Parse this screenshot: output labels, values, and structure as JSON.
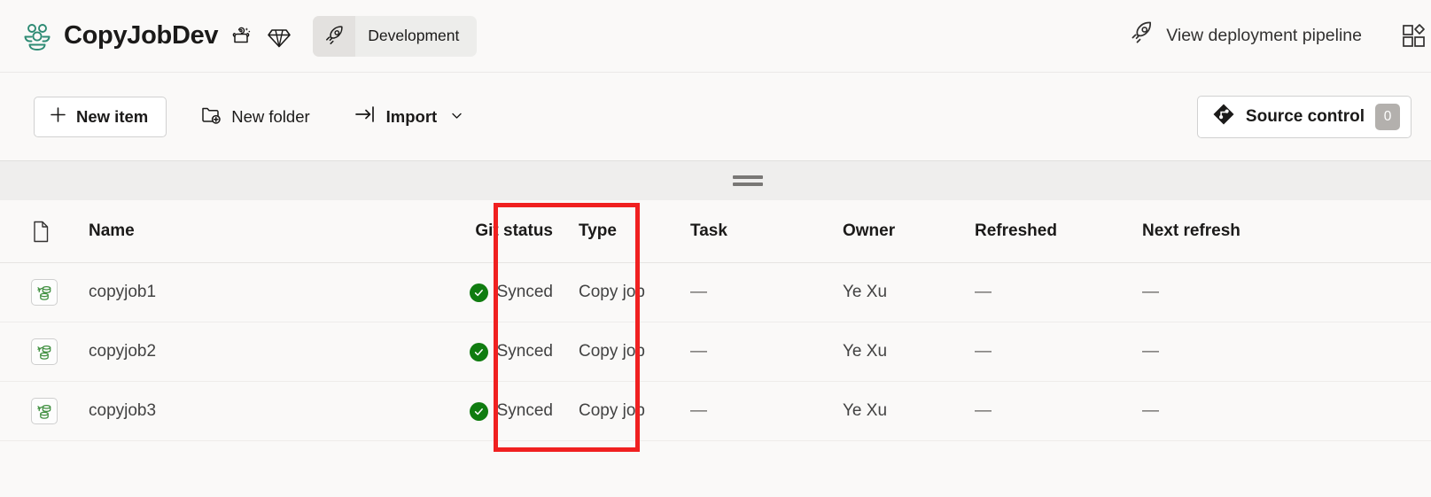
{
  "header": {
    "workspace_icon": "people-group-icon",
    "workspace_title": "CopyJobDev",
    "icons": [
      {
        "name": "copilot-sparkle-icon"
      },
      {
        "name": "premium-diamond-icon"
      }
    ],
    "stage_pill": {
      "icon": "rocket-icon",
      "label": "Development"
    },
    "deployment_link": {
      "icon": "rocket-icon",
      "label": "View deployment pipeline"
    },
    "apps_icon": "apps-grid-add-icon"
  },
  "toolbar": {
    "new_item": {
      "icon": "plus-icon",
      "label": "New item"
    },
    "new_folder": {
      "icon": "folder-add-icon",
      "label": "New folder"
    },
    "import": {
      "icon": "import-arrow-icon",
      "label": "Import",
      "chevron": "chevron-down-icon"
    },
    "source_control": {
      "icon": "git-diamond-icon",
      "label": "Source control",
      "badge": "0"
    }
  },
  "drag_band": {
    "handle": "drag-handle-icon"
  },
  "table": {
    "columns": {
      "icon": "file-icon",
      "name": "Name",
      "git_status": "Git status",
      "type": "Type",
      "task": "Task",
      "owner": "Owner",
      "refreshed": "Refreshed",
      "next_refresh": "Next refresh"
    },
    "rows": [
      {
        "icon": "copy-job-icon",
        "name": "copyjob1",
        "git_status": "Synced",
        "git_status_icon": "check-circle-icon",
        "type": "Copy job",
        "task": "—",
        "owner": "Ye Xu",
        "refreshed": "—",
        "next_refresh": "—"
      },
      {
        "icon": "copy-job-icon",
        "name": "copyjob2",
        "git_status": "Synced",
        "git_status_icon": "check-circle-icon",
        "type": "Copy job",
        "task": "—",
        "owner": "Ye Xu",
        "refreshed": "—",
        "next_refresh": "—"
      },
      {
        "icon": "copy-job-icon",
        "name": "copyjob3",
        "git_status": "Synced",
        "git_status_icon": "check-circle-icon",
        "type": "Copy job",
        "task": "—",
        "owner": "Ye Xu",
        "refreshed": "—",
        "next_refresh": "—"
      }
    ]
  },
  "annotation": {
    "shape": "rectangle-highlight",
    "color": "#f02020",
    "target": "Git status"
  },
  "colors": {
    "page_background": "#faf9f8",
    "synced_green": "#107c10",
    "workspace_icon_teal": "#2e8b74",
    "annotation_red": "#f02020",
    "badge_gray": "#b3b0ad"
  }
}
